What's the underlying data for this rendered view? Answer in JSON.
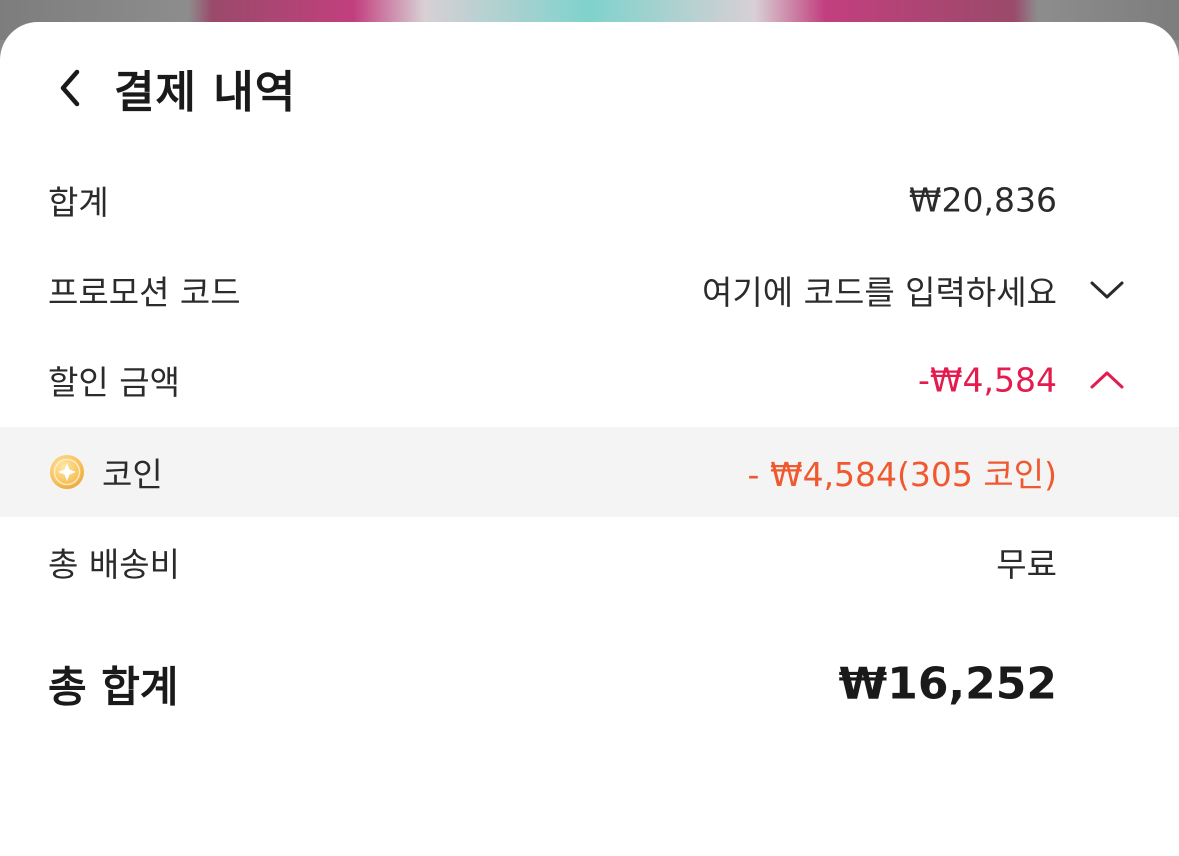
{
  "header": {
    "title": "결제 내역"
  },
  "rows": {
    "subtotal": {
      "label": "합계",
      "value": "₩20,836"
    },
    "promo": {
      "label": "프로모션 코드",
      "placeholder": "여기에 코드를 입력하세요"
    },
    "discount": {
      "label": "할인 금액",
      "value": "-₩4,584"
    },
    "coin": {
      "label": "코인",
      "value": "- ₩4,584(305 코인)"
    },
    "shipping": {
      "label": "총 배송비",
      "value": "무료"
    },
    "total": {
      "label": "총 합계",
      "value": "₩16,252"
    }
  },
  "icons": {
    "back": "chevron-left-icon",
    "promo_toggle": "chevron-down-icon",
    "discount_toggle": "chevron-up-icon",
    "coin": "coin-icon"
  },
  "colors": {
    "discount": "#e31b4e",
    "coin_value": "#f0592f",
    "coin_row_bg": "#f4f4f4"
  }
}
